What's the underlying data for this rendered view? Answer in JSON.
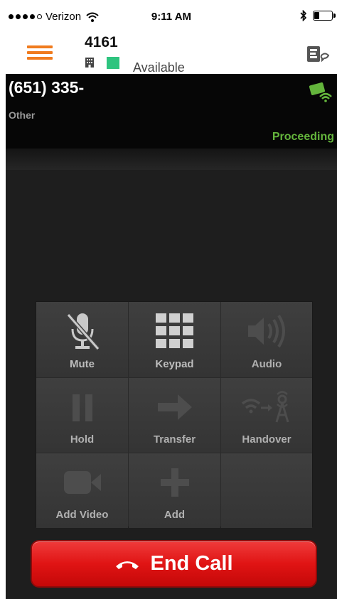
{
  "status_bar": {
    "carrier": "Verizon",
    "time": "9:11 AM"
  },
  "header": {
    "extension": "4161",
    "presence": "Available",
    "presence_color": "#2ec47f",
    "accent": "#f07b1e",
    "menu_icon": "hamburger-icon",
    "right_icon": "contacts-chat-icon"
  },
  "call": {
    "number": "(651) 335-",
    "label": "Other",
    "state": "Proceeding",
    "state_color": "#64b53c",
    "indicator_icon": "video-wifi-icon"
  },
  "controls": [
    {
      "label": "Mute",
      "icon": "microphone-muted-icon"
    },
    {
      "label": "Keypad",
      "icon": "keypad-icon"
    },
    {
      "label": "Audio",
      "icon": "speaker-icon"
    },
    {
      "label": "Hold",
      "icon": "pause-icon"
    },
    {
      "label": "Transfer",
      "icon": "arrow-right-icon"
    },
    {
      "label": "Handover",
      "icon": "wifi-to-tower-icon"
    },
    {
      "label": "Add Video",
      "icon": "video-camera-icon"
    },
    {
      "label": "Add",
      "icon": "plus-icon"
    }
  ],
  "end_call": {
    "label": "End Call",
    "icon": "hang-up-icon",
    "color": "#e01414"
  }
}
